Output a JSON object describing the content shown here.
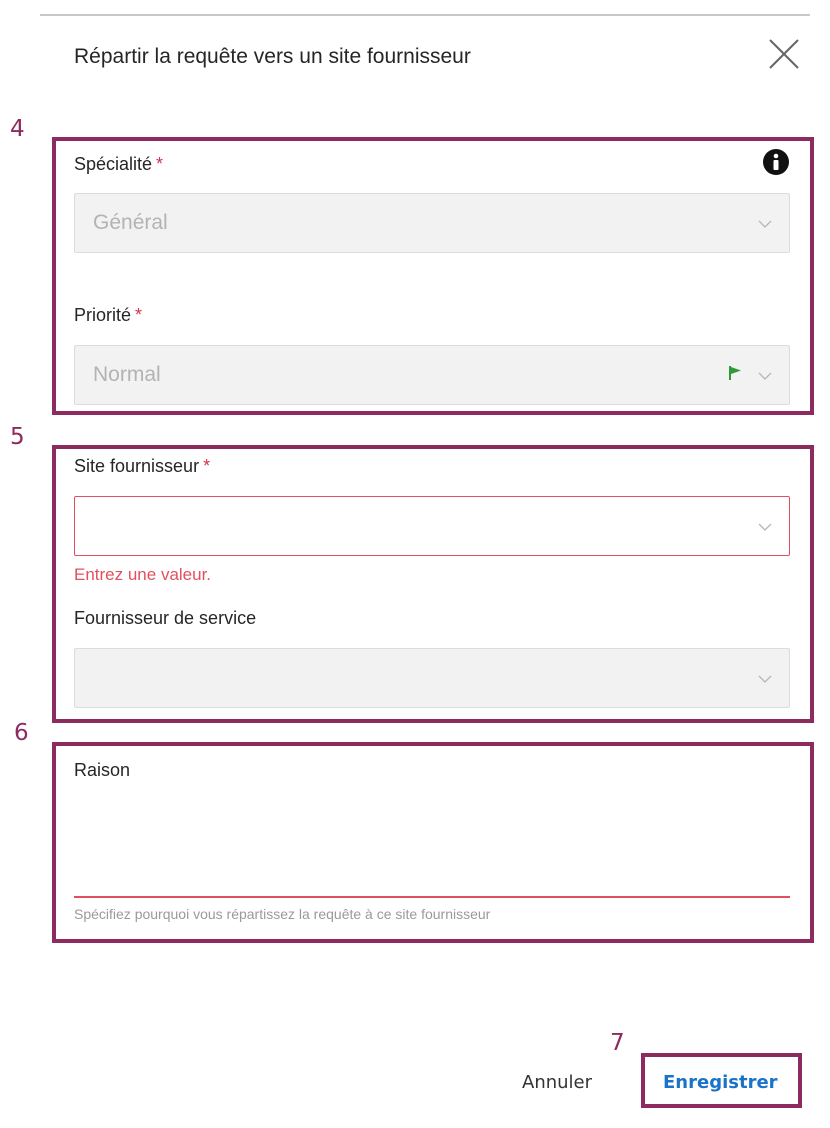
{
  "dialog": {
    "title": "Répartir la requête vers un site fournisseur",
    "close_icon": "close-icon"
  },
  "steps": {
    "group_1": "4",
    "group_2": "5",
    "group_3": "6",
    "group_4": "7"
  },
  "specialty": {
    "label": "Spécialité",
    "required_mark": "*",
    "value": "Général",
    "info_icon": "info-icon"
  },
  "priority": {
    "label": "Priorité",
    "required_mark": "*",
    "value": "Normal",
    "flag_icon": "flag-icon",
    "flag_color": "#2e9a3a"
  },
  "supplier_site": {
    "label": "Site fournisseur",
    "required_mark": "*",
    "value": "",
    "error": "Entrez une valeur."
  },
  "service_provider": {
    "label": "Fournisseur de service",
    "value": ""
  },
  "reason": {
    "label": "Raison",
    "value": "",
    "hint": "Spécifiez pourquoi vous répartissez la requête à ce site fournisseur"
  },
  "actions": {
    "cancel_label": "Annuler",
    "save_label": "Enregistrer"
  },
  "colors": {
    "annotation": "#8d2a5f",
    "required": "#d3334a",
    "error": "#e2505f",
    "primary": "#1a73c9"
  }
}
